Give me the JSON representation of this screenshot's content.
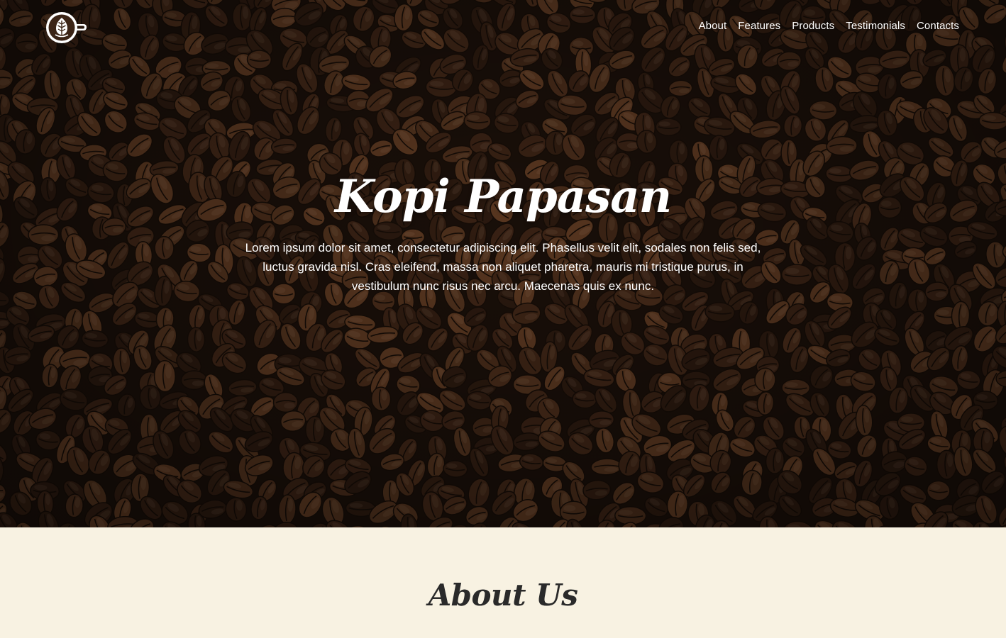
{
  "nav": {
    "logo_icon": "coffee-cup-latte-art-icon",
    "links": [
      "About",
      "Features",
      "Products",
      "Testimonials",
      "Contacts"
    ]
  },
  "hero": {
    "title": "Kopi Papasan",
    "text": "Lorem ipsum dolor sit amet, consectetur adipiscing elit. Phasellus velit elit, sodales non felis sed, luctus gravida nisl. Cras eleifend, massa non aliquet pharetra, mauris mi tristique purus, in vestibulum nunc risus nec arcu. Maecenas quis ex nunc.",
    "background": "coffee-beans-image"
  },
  "about": {
    "title": "About Us"
  },
  "colors": {
    "hero_text": "#ffffff",
    "about_background": "#f8f2e2",
    "about_title": "#2a2a2a",
    "bean_dark": "#2a1a10",
    "bean_mid": "#5a3520"
  }
}
